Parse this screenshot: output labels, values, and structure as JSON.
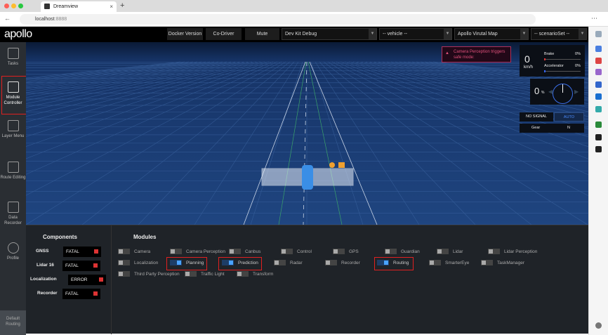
{
  "browser": {
    "tab_title": "Dreamview",
    "url_host": "localhost",
    "url_port": ":8888"
  },
  "header": {
    "logo": "apollo",
    "buttons": [
      "Docker Version",
      "Co-Driver",
      "Mute"
    ],
    "selects": [
      "Dev Kit Debug",
      "-- vehicle --",
      "Apollo Virutal Map",
      "-- scenarioSet --"
    ]
  },
  "sidebar": {
    "items": [
      {
        "label": "Tasks"
      },
      {
        "label": "Module Controller",
        "active": true
      },
      {
        "label": "Layer Menu"
      },
      {
        "label": "Route Editing"
      },
      {
        "label": "Data Recorder"
      },
      {
        "label": "Profile"
      }
    ],
    "bottom": "Default Routing"
  },
  "hud": {
    "alert": "Camera Perception triggers safe mode:",
    "speed": "0",
    "speed_unit": "km/h",
    "brake_label": "Brake",
    "brake_value": "0%",
    "accel_label": "Accelerator",
    "accel_value": "0%",
    "steering": "0",
    "steering_unit": "%",
    "signal": "NO SIGNAL",
    "mode": "AUTO",
    "gear_label": "Gear",
    "gear_value": "N"
  },
  "components": {
    "title": "Components",
    "items": [
      {
        "name": "GNSS",
        "status": "FATAL"
      },
      {
        "name": "Lidar 16",
        "status": "FATAL"
      },
      {
        "name": "Localization",
        "status": "ERROR"
      },
      {
        "name": "Recorder",
        "status": "FATAL"
      }
    ]
  },
  "modules": {
    "title": "Modules",
    "items": [
      {
        "label": "Camera",
        "on": false
      },
      {
        "label": "Camera Perception",
        "on": false
      },
      {
        "label": "Canbus",
        "on": false
      },
      {
        "label": "Control",
        "on": false
      },
      {
        "label": "GPS",
        "on": false
      },
      {
        "label": "Guardian",
        "on": false
      },
      {
        "label": "Lidar",
        "on": false
      },
      {
        "label": "Lidar Perception",
        "on": false
      },
      {
        "label": "Localization",
        "on": false
      },
      {
        "label": "Planning",
        "on": true
      },
      {
        "label": "Prediction",
        "on": true
      },
      {
        "label": "Radar",
        "on": false
      },
      {
        "label": "Recorder",
        "on": false
      },
      {
        "label": "Routing",
        "on": true
      },
      {
        "label": "SmarterEye",
        "on": false
      },
      {
        "label": "TaskManager",
        "on": false
      },
      {
        "label": "Third Party Perception",
        "on": false
      },
      {
        "label": "Traffic Light",
        "on": false
      },
      {
        "label": "Transform",
        "on": false
      }
    ]
  },
  "colors": {
    "accent": "#4aa3ff",
    "highlight": "#e02020",
    "fatal": "#dd3333",
    "scene": "#1b3a6b"
  }
}
